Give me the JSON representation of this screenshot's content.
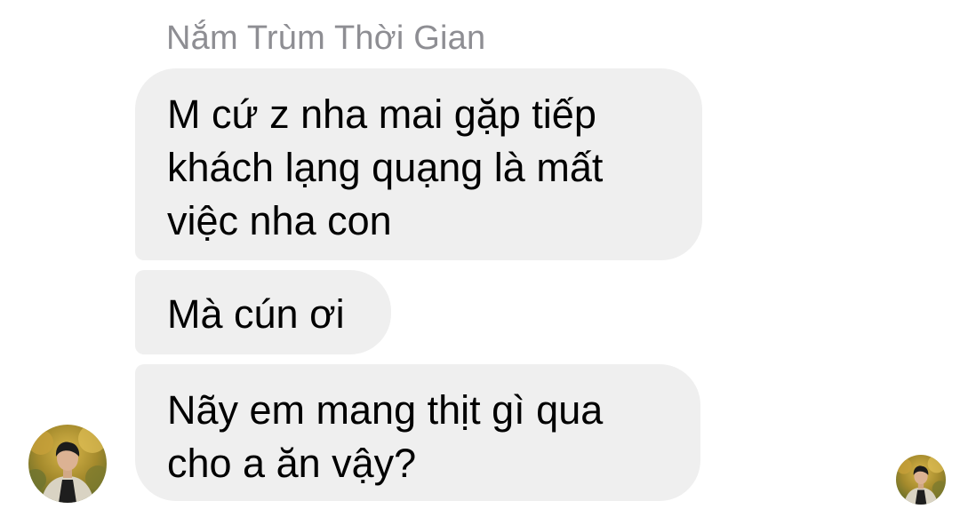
{
  "conversation": {
    "sender_name": "Nắm Trùm Thời Gian",
    "messages": [
      {
        "lines": [
          "M cứ z nha mai gặp tiếp",
          "khách lạng quạng là mất",
          "việc nha con"
        ]
      },
      {
        "lines": [
          "Mà cún ơi"
        ]
      },
      {
        "lines": [
          "Nãy em mang thịt gì qua",
          "cho a ăn vậy?"
        ]
      }
    ],
    "sender_avatar_icon": "profile-photo-avatar",
    "seen_indicator_icon": "seen-avatar"
  },
  "colors": {
    "bubble_background": "#efefef",
    "sender_name_text": "#8e8e93",
    "message_text": "#000000",
    "page_background": "#ffffff"
  }
}
